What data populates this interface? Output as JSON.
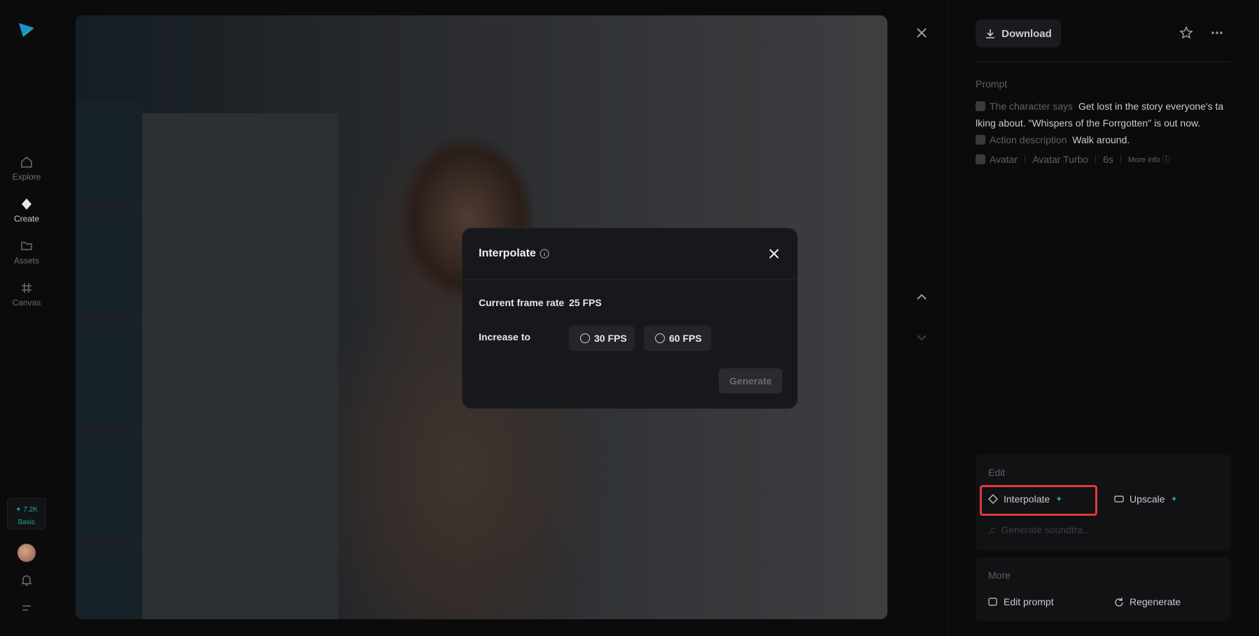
{
  "nav": {
    "items": [
      {
        "label": "Explore",
        "icon": "home-icon"
      },
      {
        "label": "Create",
        "icon": "diamond-icon"
      },
      {
        "label": "Assets",
        "icon": "folder-icon"
      },
      {
        "label": "Canvas",
        "icon": "hash-icon"
      }
    ],
    "credits": {
      "amount": "✦ 7.2K",
      "plan": "Basic"
    }
  },
  "toolbar": {
    "download_label": "Download"
  },
  "prompt": {
    "label": "Prompt",
    "character_says_tag": "The character says",
    "character_says_text": "Get lost in the story everyone's ta lking about. \"Whispers of the Forrgotten\" is out now.",
    "action_tag": "Action description",
    "action_text": "Walk around.",
    "meta": {
      "model": "Avatar",
      "variant": "Avatar Turbo",
      "duration": "6s",
      "more_info": "More info"
    }
  },
  "edit": {
    "title": "Edit",
    "interpolate": "Interpolate",
    "upscale": "Upscale",
    "soundtrack": "Generate soundtra..."
  },
  "more": {
    "title": "More",
    "edit_prompt": "Edit prompt",
    "regenerate": "Regenerate"
  },
  "modal": {
    "title": "Interpolate",
    "current_label": "Current frame rate",
    "current_value": "25 FPS",
    "increase_label": "Increase to",
    "options": [
      "30 FPS",
      "60 FPS"
    ],
    "generate_label": "Generate"
  },
  "colors": {
    "accent": "#1aa7a1",
    "highlight": "#e0393e"
  }
}
